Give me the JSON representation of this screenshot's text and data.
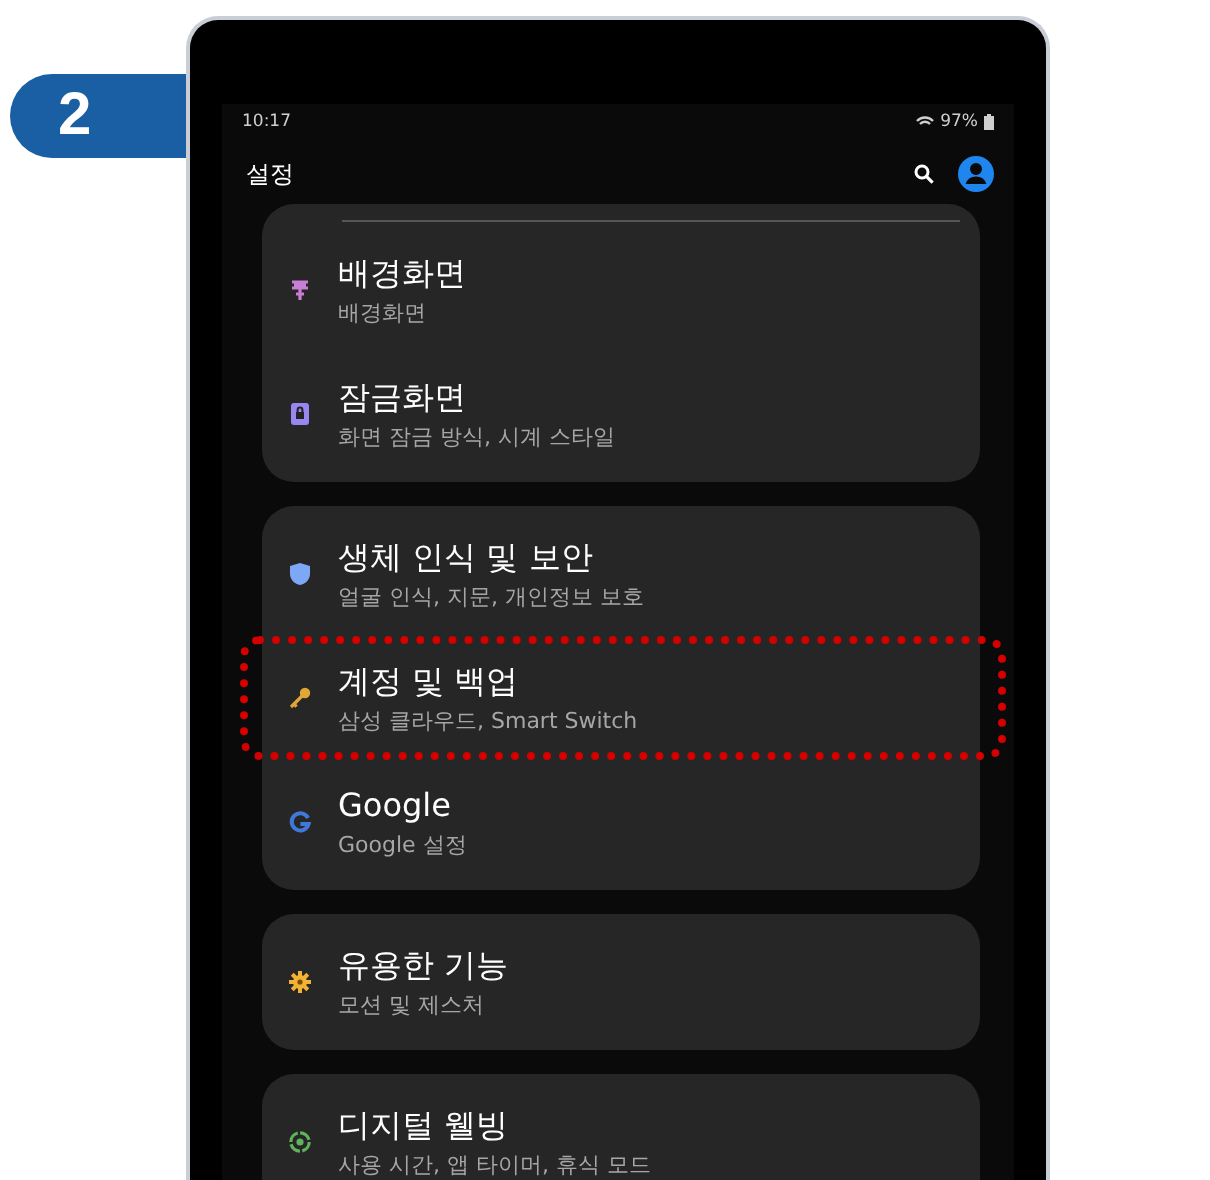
{
  "step_badge": "2",
  "status_bar": {
    "time": "10:17",
    "battery": "97%"
  },
  "header": {
    "title": "설정"
  },
  "groups": [
    {
      "items": [
        {
          "kind": "wallpaper",
          "color": "#c77fd6",
          "title": "배경화면",
          "subtitle": "배경화면",
          "highlighted": false
        },
        {
          "kind": "lock",
          "color": "#9a86f0",
          "title": "잠금화면",
          "subtitle": "화면 잠금 방식, 시계 스타일",
          "highlighted": false
        }
      ],
      "top_divider": true
    },
    {
      "items": [
        {
          "kind": "shield",
          "color": "#7ea7f5",
          "title": "생체 인식 및 보안",
          "subtitle": "얼굴 인식, 지문, 개인정보 보호",
          "highlighted": false
        },
        {
          "kind": "key",
          "color": "#e0a735",
          "title": "계정 및 백업",
          "subtitle": "삼성 클라우드, Smart Switch",
          "highlighted": true
        },
        {
          "kind": "google",
          "color": "#3f78d8",
          "title": "Google",
          "subtitle": "Google 설정",
          "highlighted": false
        }
      ],
      "top_divider": false
    },
    {
      "items": [
        {
          "kind": "gear",
          "color": "#f2b233",
          "title": "유용한 기능",
          "subtitle": "모션 및 제스처",
          "highlighted": false
        }
      ],
      "top_divider": false
    },
    {
      "items": [
        {
          "kind": "wellbeing",
          "color": "#5fb35a",
          "title": "디지털 웰빙",
          "subtitle": "사용 시간, 앱 타이머, 휴식 모드",
          "highlighted": false
        }
      ],
      "top_divider": false
    }
  ]
}
